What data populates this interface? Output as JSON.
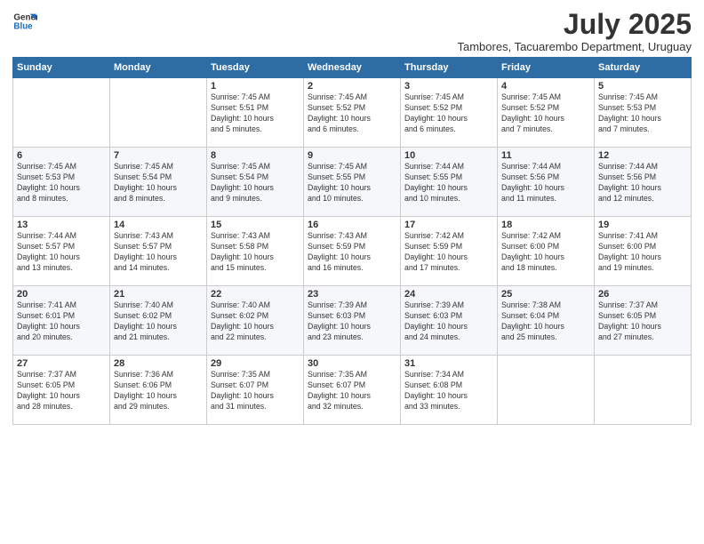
{
  "logo": {
    "general": "General",
    "blue": "Blue"
  },
  "title": "July 2025",
  "subtitle": "Tambores, Tacuarembo Department, Uruguay",
  "days_header": [
    "Sunday",
    "Monday",
    "Tuesday",
    "Wednesday",
    "Thursday",
    "Friday",
    "Saturday"
  ],
  "weeks": [
    [
      {
        "day": "",
        "data": ""
      },
      {
        "day": "",
        "data": ""
      },
      {
        "day": "1",
        "data": "Sunrise: 7:45 AM\nSunset: 5:51 PM\nDaylight: 10 hours\nand 5 minutes."
      },
      {
        "day": "2",
        "data": "Sunrise: 7:45 AM\nSunset: 5:52 PM\nDaylight: 10 hours\nand 6 minutes."
      },
      {
        "day": "3",
        "data": "Sunrise: 7:45 AM\nSunset: 5:52 PM\nDaylight: 10 hours\nand 6 minutes."
      },
      {
        "day": "4",
        "data": "Sunrise: 7:45 AM\nSunset: 5:52 PM\nDaylight: 10 hours\nand 7 minutes."
      },
      {
        "day": "5",
        "data": "Sunrise: 7:45 AM\nSunset: 5:53 PM\nDaylight: 10 hours\nand 7 minutes."
      }
    ],
    [
      {
        "day": "6",
        "data": "Sunrise: 7:45 AM\nSunset: 5:53 PM\nDaylight: 10 hours\nand 8 minutes."
      },
      {
        "day": "7",
        "data": "Sunrise: 7:45 AM\nSunset: 5:54 PM\nDaylight: 10 hours\nand 8 minutes."
      },
      {
        "day": "8",
        "data": "Sunrise: 7:45 AM\nSunset: 5:54 PM\nDaylight: 10 hours\nand 9 minutes."
      },
      {
        "day": "9",
        "data": "Sunrise: 7:45 AM\nSunset: 5:55 PM\nDaylight: 10 hours\nand 10 minutes."
      },
      {
        "day": "10",
        "data": "Sunrise: 7:44 AM\nSunset: 5:55 PM\nDaylight: 10 hours\nand 10 minutes."
      },
      {
        "day": "11",
        "data": "Sunrise: 7:44 AM\nSunset: 5:56 PM\nDaylight: 10 hours\nand 11 minutes."
      },
      {
        "day": "12",
        "data": "Sunrise: 7:44 AM\nSunset: 5:56 PM\nDaylight: 10 hours\nand 12 minutes."
      }
    ],
    [
      {
        "day": "13",
        "data": "Sunrise: 7:44 AM\nSunset: 5:57 PM\nDaylight: 10 hours\nand 13 minutes."
      },
      {
        "day": "14",
        "data": "Sunrise: 7:43 AM\nSunset: 5:57 PM\nDaylight: 10 hours\nand 14 minutes."
      },
      {
        "day": "15",
        "data": "Sunrise: 7:43 AM\nSunset: 5:58 PM\nDaylight: 10 hours\nand 15 minutes."
      },
      {
        "day": "16",
        "data": "Sunrise: 7:43 AM\nSunset: 5:59 PM\nDaylight: 10 hours\nand 16 minutes."
      },
      {
        "day": "17",
        "data": "Sunrise: 7:42 AM\nSunset: 5:59 PM\nDaylight: 10 hours\nand 17 minutes."
      },
      {
        "day": "18",
        "data": "Sunrise: 7:42 AM\nSunset: 6:00 PM\nDaylight: 10 hours\nand 18 minutes."
      },
      {
        "day": "19",
        "data": "Sunrise: 7:41 AM\nSunset: 6:00 PM\nDaylight: 10 hours\nand 19 minutes."
      }
    ],
    [
      {
        "day": "20",
        "data": "Sunrise: 7:41 AM\nSunset: 6:01 PM\nDaylight: 10 hours\nand 20 minutes."
      },
      {
        "day": "21",
        "data": "Sunrise: 7:40 AM\nSunset: 6:02 PM\nDaylight: 10 hours\nand 21 minutes."
      },
      {
        "day": "22",
        "data": "Sunrise: 7:40 AM\nSunset: 6:02 PM\nDaylight: 10 hours\nand 22 minutes."
      },
      {
        "day": "23",
        "data": "Sunrise: 7:39 AM\nSunset: 6:03 PM\nDaylight: 10 hours\nand 23 minutes."
      },
      {
        "day": "24",
        "data": "Sunrise: 7:39 AM\nSunset: 6:03 PM\nDaylight: 10 hours\nand 24 minutes."
      },
      {
        "day": "25",
        "data": "Sunrise: 7:38 AM\nSunset: 6:04 PM\nDaylight: 10 hours\nand 25 minutes."
      },
      {
        "day": "26",
        "data": "Sunrise: 7:37 AM\nSunset: 6:05 PM\nDaylight: 10 hours\nand 27 minutes."
      }
    ],
    [
      {
        "day": "27",
        "data": "Sunrise: 7:37 AM\nSunset: 6:05 PM\nDaylight: 10 hours\nand 28 minutes."
      },
      {
        "day": "28",
        "data": "Sunrise: 7:36 AM\nSunset: 6:06 PM\nDaylight: 10 hours\nand 29 minutes."
      },
      {
        "day": "29",
        "data": "Sunrise: 7:35 AM\nSunset: 6:07 PM\nDaylight: 10 hours\nand 31 minutes."
      },
      {
        "day": "30",
        "data": "Sunrise: 7:35 AM\nSunset: 6:07 PM\nDaylight: 10 hours\nand 32 minutes."
      },
      {
        "day": "31",
        "data": "Sunrise: 7:34 AM\nSunset: 6:08 PM\nDaylight: 10 hours\nand 33 minutes."
      },
      {
        "day": "",
        "data": ""
      },
      {
        "day": "",
        "data": ""
      }
    ]
  ]
}
